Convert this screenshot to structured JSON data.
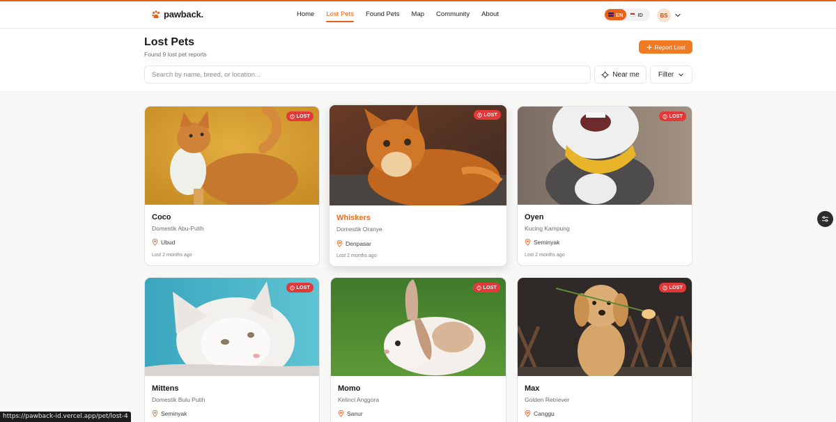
{
  "brand": {
    "name": "pawback.",
    "accent": "#e8611a"
  },
  "nav": {
    "links": [
      {
        "label": "Home",
        "active": false
      },
      {
        "label": "Lost Pets",
        "active": true
      },
      {
        "label": "Found Pets",
        "active": false
      },
      {
        "label": "Map",
        "active": false
      },
      {
        "label": "Community",
        "active": false
      },
      {
        "label": "About",
        "active": false
      }
    ],
    "languages": [
      {
        "code": "EN",
        "active": true
      },
      {
        "code": "ID",
        "active": false
      }
    ],
    "user_initials": "BS"
  },
  "page": {
    "title": "Lost Pets",
    "subtitle": "Found 9 lost pet reports",
    "report_button": "Report Lost",
    "search_placeholder": "Search by name, breed, or location...",
    "near_me": "Near me",
    "filter": "Filter"
  },
  "cards": [
    {
      "name": "Coco",
      "breed": "Domestik Abu-Putih",
      "location": "Ubud",
      "time": "Lost 2 months ago",
      "badge": "LOST",
      "image": "orange-tabby-cat"
    },
    {
      "name": "Whiskers",
      "breed": "Domestik Oranye",
      "location": "Denpasar",
      "time": "Lost 2 months ago",
      "badge": "LOST",
      "image": "orange-longhair-cat"
    },
    {
      "name": "Oyen",
      "breed": "Kucing Kampung",
      "location": "Seminyak",
      "time": "Lost 2 months ago",
      "badge": "LOST",
      "image": "cat-yellow-bandana"
    },
    {
      "name": "Mittens",
      "breed": "Domestik Bulu Putih",
      "location": "Seminyak",
      "time": "",
      "badge": "LOST",
      "image": "white-longhair-cat"
    },
    {
      "name": "Momo",
      "breed": "Kelinci Anggora",
      "location": "Sanur",
      "time": "",
      "badge": "LOST",
      "image": "lop-rabbit"
    },
    {
      "name": "Max",
      "breed": "Golden Retriever",
      "location": "Canggu",
      "time": "",
      "badge": "LOST",
      "image": "golden-retriever-flower"
    }
  ],
  "status_bar_url": "https://pawback-id.vercel.app/pet/lost-4"
}
